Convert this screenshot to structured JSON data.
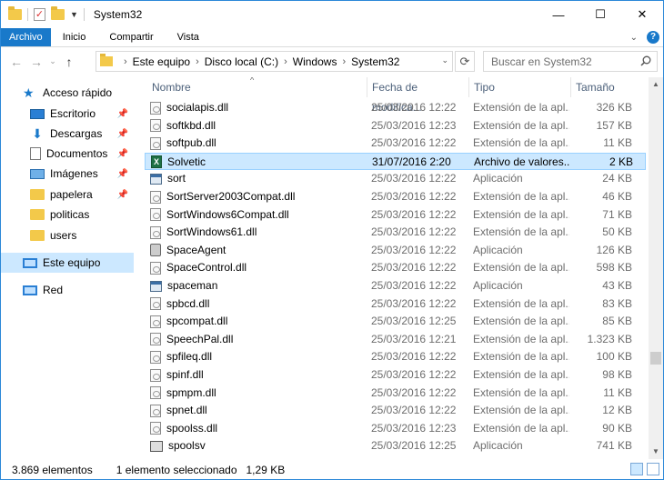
{
  "window": {
    "title": "System32",
    "controls": {
      "minimize": "—",
      "maximize": "☐",
      "close": "✕"
    }
  },
  "ribbon": {
    "tabs": [
      "Archivo",
      "Inicio",
      "Compartir",
      "Vista"
    ]
  },
  "address": {
    "crumbs": [
      "Este equipo",
      "Disco local (C:)",
      "Windows",
      "System32"
    ],
    "search_placeholder": "Buscar en System32"
  },
  "sidebar": {
    "items": [
      {
        "label": "Acceso rápido",
        "icon": "star-icon",
        "pinned": false
      },
      {
        "label": "Escritorio",
        "icon": "desktop-icon",
        "pinned": true
      },
      {
        "label": "Descargas",
        "icon": "download-icon",
        "pinned": true
      },
      {
        "label": "Documentos",
        "icon": "documents-icon",
        "pinned": true
      },
      {
        "label": "Imágenes",
        "icon": "images-icon",
        "pinned": true
      },
      {
        "label": "papelera",
        "icon": "folder-icon",
        "pinned": true
      },
      {
        "label": "politicas",
        "icon": "folder-icon",
        "pinned": false
      },
      {
        "label": "users",
        "icon": "folder-icon",
        "pinned": false
      },
      {
        "label": "Este equipo",
        "icon": "computer-icon",
        "pinned": false,
        "selected": true
      },
      {
        "label": "Red",
        "icon": "network-icon",
        "pinned": false
      }
    ],
    "pin_glyph": "📌"
  },
  "list": {
    "columns": [
      "Nombre",
      "Fecha de modifica...",
      "Tipo",
      "Tamaño"
    ],
    "rows": [
      {
        "name": "socialapis.dll",
        "date": "25/03/2016 12:22",
        "type": "Extensión de la apl...",
        "size": "326 KB",
        "icon": "dll"
      },
      {
        "name": "softkbd.dll",
        "date": "25/03/2016 12:23",
        "type": "Extensión de la apl...",
        "size": "157 KB",
        "icon": "dll"
      },
      {
        "name": "softpub.dll",
        "date": "25/03/2016 12:22",
        "type": "Extensión de la apl...",
        "size": "11 KB",
        "icon": "dll"
      },
      {
        "name": "Solvetic",
        "date": "31/07/2016 2:20",
        "type": "Archivo de valores...",
        "size": "2 KB",
        "icon": "csv",
        "selected": true
      },
      {
        "name": "sort",
        "date": "25/03/2016 12:22",
        "type": "Aplicación",
        "size": "24 KB",
        "icon": "exe"
      },
      {
        "name": "SortServer2003Compat.dll",
        "date": "25/03/2016 12:22",
        "type": "Extensión de la apl...",
        "size": "46 KB",
        "icon": "dll"
      },
      {
        "name": "SortWindows6Compat.dll",
        "date": "25/03/2016 12:22",
        "type": "Extensión de la apl...",
        "size": "71 KB",
        "icon": "dll"
      },
      {
        "name": "SortWindows61.dll",
        "date": "25/03/2016 12:22",
        "type": "Extensión de la apl...",
        "size": "50 KB",
        "icon": "dll"
      },
      {
        "name": "SpaceAgent",
        "date": "25/03/2016 12:22",
        "type": "Aplicación",
        "size": "126 KB",
        "icon": "agent"
      },
      {
        "name": "SpaceControl.dll",
        "date": "25/03/2016 12:22",
        "type": "Extensión de la apl...",
        "size": "598 KB",
        "icon": "dll"
      },
      {
        "name": "spaceman",
        "date": "25/03/2016 12:22",
        "type": "Aplicación",
        "size": "43 KB",
        "icon": "exe"
      },
      {
        "name": "spbcd.dll",
        "date": "25/03/2016 12:22",
        "type": "Extensión de la apl...",
        "size": "83 KB",
        "icon": "dll"
      },
      {
        "name": "spcompat.dll",
        "date": "25/03/2016 12:25",
        "type": "Extensión de la apl...",
        "size": "85 KB",
        "icon": "dll"
      },
      {
        "name": "SpeechPal.dll",
        "date": "25/03/2016 12:21",
        "type": "Extensión de la apl...",
        "size": "1.323 KB",
        "icon": "dll"
      },
      {
        "name": "spfileq.dll",
        "date": "25/03/2016 12:22",
        "type": "Extensión de la apl...",
        "size": "100 KB",
        "icon": "dll"
      },
      {
        "name": "spinf.dll",
        "date": "25/03/2016 12:22",
        "type": "Extensión de la apl...",
        "size": "98 KB",
        "icon": "dll"
      },
      {
        "name": "spmpm.dll",
        "date": "25/03/2016 12:22",
        "type": "Extensión de la apl...",
        "size": "11 KB",
        "icon": "dll"
      },
      {
        "name": "spnet.dll",
        "date": "25/03/2016 12:22",
        "type": "Extensión de la apl...",
        "size": "12 KB",
        "icon": "dll"
      },
      {
        "name": "spoolss.dll",
        "date": "25/03/2016 12:23",
        "type": "Extensión de la apl...",
        "size": "90 KB",
        "icon": "dll"
      },
      {
        "name": "spoolsv",
        "date": "25/03/2016 12:25",
        "type": "Aplicación",
        "size": "741 KB",
        "icon": "printer"
      }
    ]
  },
  "status": {
    "count": "3.869 elementos",
    "selection": "1 elemento seleccionado",
    "selection_size": "1,29 KB"
  }
}
